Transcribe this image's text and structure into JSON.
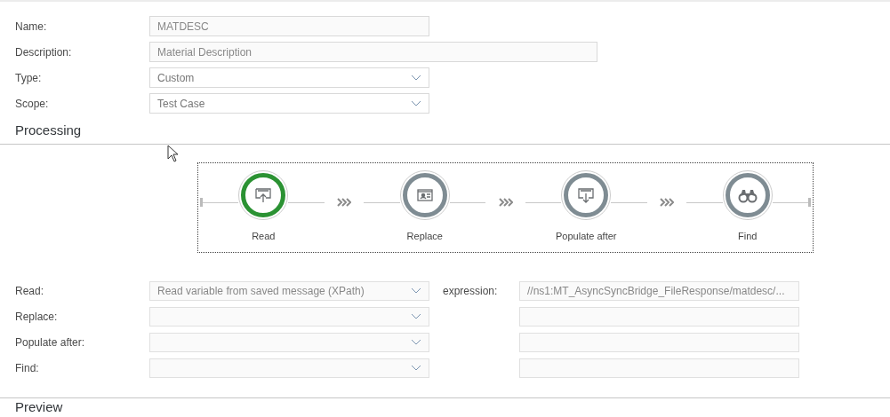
{
  "form": [
    {
      "label": "Name:",
      "value": "MATDESC",
      "kind": "text"
    },
    {
      "label": "Description:",
      "value": "Material Description",
      "kind": "wide_text"
    },
    {
      "label": "Type:",
      "value": "Custom",
      "kind": "select"
    },
    {
      "label": "Scope:",
      "value": "Test Case",
      "kind": "select"
    }
  ],
  "processing": {
    "title": "Processing",
    "steps": [
      {
        "label": "Read",
        "kind": "upload",
        "selected": true
      },
      {
        "label": "Replace",
        "kind": "card",
        "selected": false
      },
      {
        "label": "Populate after",
        "kind": "download",
        "selected": false
      },
      {
        "label": "Find",
        "kind": "binoculars",
        "selected": false
      }
    ],
    "settings": [
      {
        "label": "Read:",
        "value": "Read variable from saved message (XPath)",
        "expression_label": "expression:",
        "expression": "//ns1:MT_AsyncSyncBridge_FileResponse/matdesc/..."
      },
      {
        "label": "Replace:"
      },
      {
        "label": "Populate after:"
      },
      {
        "label": "Find:"
      }
    ]
  },
  "preview": {
    "title": "Preview"
  }
}
